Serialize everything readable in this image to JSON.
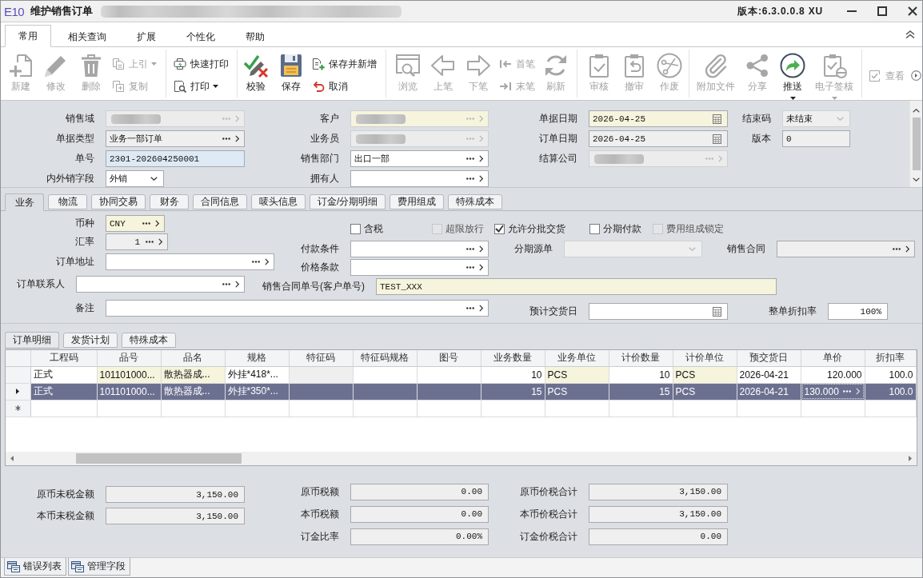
{
  "window": {
    "logo": "E10",
    "title": "维护销售订单",
    "subtitle_redacted": true,
    "version": "版本:6.3.0.0.8 XU"
  },
  "menu_tabs": [
    {
      "label": "常用",
      "selected": true
    },
    {
      "label": "相关查询",
      "selected": false
    },
    {
      "label": "扩展",
      "selected": false
    },
    {
      "label": "个性化",
      "selected": false
    },
    {
      "label": "帮助",
      "selected": false
    }
  ],
  "toolbar": {
    "groups": [
      {
        "items": [
          {
            "kind": "large",
            "label": "新建",
            "disabled": true,
            "dropdown": false
          },
          {
            "kind": "large",
            "label": "修改",
            "disabled": true,
            "dropdown": false
          },
          {
            "kind": "large",
            "label": "删除",
            "disabled": true,
            "dropdown": false
          },
          {
            "kind": "stack",
            "buttons": [
              {
                "label": "上引",
                "disabled": true,
                "dropdown": true
              },
              {
                "label": "复制",
                "disabled": true,
                "dropdown": false
              }
            ]
          }
        ]
      },
      {
        "items": [
          {
            "kind": "stack",
            "buttons": [
              {
                "label": "快速打印",
                "disabled": false,
                "dropdown": false
              },
              {
                "label": "打印",
                "disabled": false,
                "dropdown": true
              }
            ]
          }
        ]
      },
      {
        "items": [
          {
            "kind": "large",
            "label": "校验",
            "disabled": false,
            "dropdown": false
          },
          {
            "kind": "large",
            "label": "保存",
            "disabled": false,
            "dropdown": false
          },
          {
            "kind": "stack",
            "buttons": [
              {
                "label": "保存并新增",
                "disabled": false,
                "dropdown": false
              },
              {
                "label": "取消",
                "disabled": false,
                "dropdown": false
              }
            ]
          }
        ]
      },
      {
        "items": [
          {
            "kind": "large",
            "label": "浏览",
            "disabled": true,
            "dropdown": false
          },
          {
            "kind": "large",
            "label": "上笔",
            "disabled": true,
            "dropdown": false
          },
          {
            "kind": "large",
            "label": "下笔",
            "disabled": true,
            "dropdown": false
          },
          {
            "kind": "stack",
            "buttons": [
              {
                "label": "首笔",
                "disabled": true,
                "dropdown": false
              },
              {
                "label": "末笔",
                "disabled": true,
                "dropdown": false
              }
            ]
          },
          {
            "kind": "large",
            "label": "刷新",
            "disabled": true,
            "dropdown": false
          }
        ]
      },
      {
        "items": [
          {
            "kind": "large",
            "label": "审核",
            "disabled": true,
            "dropdown": false
          },
          {
            "kind": "large",
            "label": "撤审",
            "disabled": true,
            "dropdown": false
          },
          {
            "kind": "large",
            "label": "作废",
            "disabled": true,
            "dropdown": false
          }
        ]
      },
      {
        "items": [
          {
            "kind": "large",
            "label": "附加文件",
            "disabled": true,
            "dropdown": false
          },
          {
            "kind": "large",
            "label": "分享",
            "disabled": true,
            "dropdown": false
          },
          {
            "kind": "large",
            "label": "推送",
            "disabled": false,
            "dropdown": true
          },
          {
            "kind": "large",
            "label": "电子签核",
            "disabled": true,
            "dropdown": true
          }
        ]
      },
      {
        "items": [
          {
            "kind": "stack",
            "buttons": [
              {
                "label": "查看",
                "disabled": true,
                "dropdown": false
              }
            ]
          }
        ]
      }
    ]
  },
  "header_form": {
    "rows": [
      [
        {
          "label": "销售域",
          "kind": "lookup",
          "color": "#ececec",
          "disabled": true,
          "redacted": true
        },
        {
          "label": "客户",
          "kind": "lookup",
          "color": "#f6f4dc",
          "disabled": true,
          "redacted": true
        },
        {
          "label": "单据日期",
          "kind": "date",
          "color": "#f6f4dc",
          "disabled": false,
          "redacted": false,
          "value": "2026-04-25"
        },
        {
          "label": "结束码",
          "kind": "dropdown",
          "color": "#efefef",
          "disabled": true,
          "redacted": false,
          "value": "未结束"
        }
      ],
      [
        {
          "label": "单据类型",
          "kind": "lookup",
          "color": "#efefef",
          "disabled": false,
          "redacted": false,
          "value": "业务一部订单"
        },
        {
          "label": "业务员",
          "kind": "lookup",
          "color": "#ececec",
          "disabled": true,
          "redacted": true
        },
        {
          "label": "订单日期",
          "kind": "date",
          "color": "#efefef",
          "disabled": false,
          "redacted": false,
          "value": "2026-04-25"
        },
        {
          "label": "版本",
          "kind": "text",
          "color": "#efefef",
          "disabled": false,
          "redacted": false,
          "value": "0"
        }
      ],
      [
        {
          "label": "单号",
          "kind": "text",
          "color": "#dde9f5",
          "disabled": false,
          "redacted": false,
          "value": "2301-202604250001"
        },
        {
          "label": "销售部门",
          "kind": "lookup",
          "color": "#ffffff",
          "disabled": false,
          "redacted": false,
          "value": "出口一部"
        },
        {
          "label": "结算公司",
          "kind": "lookup",
          "color": "#ececec",
          "disabled": true,
          "redacted": true
        }
      ],
      [
        {
          "label": "内外销字段",
          "kind": "dropdown",
          "color": "#ffffff",
          "disabled": false,
          "redacted": false,
          "value": "外销"
        },
        {
          "label": "拥有人",
          "kind": "lookup",
          "color": "#ffffff",
          "disabled": false,
          "redacted": false
        }
      ]
    ]
  },
  "form_tabs": [
    {
      "label": "业务",
      "selected": true
    },
    {
      "label": "物流",
      "selected": false
    },
    {
      "label": "协同交易",
      "selected": false
    },
    {
      "label": "财务",
      "selected": false
    },
    {
      "label": "合同信息",
      "selected": false
    },
    {
      "label": "唛头信息",
      "selected": false
    },
    {
      "label": "订金/分期明细",
      "selected": false
    },
    {
      "label": "费用组成",
      "selected": false
    },
    {
      "label": "特殊成本",
      "selected": false
    }
  ],
  "business_form": {
    "fields": [
      {
        "kind": "lookup",
        "label": "币种",
        "color": "#f6f4dc",
        "disabled": false,
        "value": "CNY"
      },
      {
        "kind": "number_lookup",
        "label": "汇率",
        "color": "#efefef",
        "disabled": false,
        "value": "1"
      },
      {
        "kind": "lookup",
        "label": "付款条件",
        "color": "#ffffff",
        "disabled": false
      },
      {
        "kind": "dropdown",
        "label": "分期源单",
        "color": "#efefef",
        "disabled": true
      },
      {
        "kind": "lookup",
        "label": "销售合同",
        "color": "#efefef",
        "disabled": false
      },
      {
        "kind": "lookup",
        "label": "订单地址",
        "color": "#ffffff",
        "disabled": false
      },
      {
        "kind": "lookup",
        "label": "价格条款",
        "color": "#ffffff",
        "disabled": false
      },
      {
        "kind": "lookup",
        "label": "订单联系人",
        "color": "#ffffff",
        "disabled": false
      },
      {
        "kind": "text",
        "label": "销售合同单号(客户单号)",
        "color": "#f6f4dc",
        "disabled": false,
        "value": "TEST_XXX"
      },
      {
        "kind": "lookup",
        "label": "备注",
        "color": "#ffffff",
        "disabled": false
      },
      {
        "kind": "date",
        "label": "预计交货日",
        "color": "#ffffff",
        "disabled": false
      },
      {
        "kind": "number",
        "label": "整单折扣率",
        "color": "#ffffff",
        "disabled": false,
        "value": "100%"
      }
    ],
    "options": [
      {
        "label": "含税",
        "checked": false,
        "disabled": false
      },
      {
        "label": "超限放行",
        "checked": false,
        "disabled": true
      },
      {
        "label": "允许分批交货",
        "checked": true,
        "disabled": false
      },
      {
        "label": "分期付款",
        "checked": false,
        "disabled": false
      },
      {
        "label": "费用组成锁定",
        "checked": false,
        "disabled": true
      }
    ]
  },
  "detail_tabs": [
    {
      "label": "订单明细",
      "selected": true
    },
    {
      "label": "发货计划",
      "selected": false
    },
    {
      "label": "特殊成本",
      "selected": false
    }
  ],
  "detail_grid": {
    "columns": [
      {
        "label": "工程码",
        "kind": "text",
        "color": "#ffffff"
      },
      {
        "label": "品号",
        "kind": "text",
        "color": "#f6f4dc"
      },
      {
        "label": "品名",
        "kind": "text",
        "color": "#f6f4dc"
      },
      {
        "label": "规格",
        "kind": "text",
        "color": "#ffffff"
      },
      {
        "label": "特征码",
        "kind": "text",
        "color": "#efefef"
      },
      {
        "label": "特征码规格",
        "kind": "text",
        "color": "#ffffff"
      },
      {
        "label": "图号",
        "kind": "text",
        "color": "#ffffff"
      },
      {
        "label": "业务数量",
        "kind": "number",
        "color": "#ffffff"
      },
      {
        "label": "业务单位",
        "kind": "text",
        "color": "#f6f4dc"
      },
      {
        "label": "计价数量",
        "kind": "number",
        "color": "#ffffff"
      },
      {
        "label": "计价单位",
        "kind": "text",
        "color": "#f6f4dc"
      },
      {
        "label": "预交货日",
        "kind": "text",
        "color": "#ffffff"
      },
      {
        "label": "单价",
        "kind": "number",
        "color": "#ffffff"
      },
      {
        "label": "折扣率",
        "kind": "number",
        "color": "#ffffff"
      }
    ],
    "rows": [
      {
        "kind": "data",
        "selected": false,
        "current": false,
        "cells": [
          {
            "text": "正式",
            "focused": false
          },
          {
            "text": "101101000...",
            "focused": false
          },
          {
            "text": "散热器成...",
            "focused": false
          },
          {
            "text": "外挂*418*...",
            "focused": false
          },
          {
            "focused": false
          },
          {
            "focused": false
          },
          {
            "focused": false
          },
          {
            "text": "10",
            "focused": false
          },
          {
            "text": "PCS",
            "focused": false
          },
          {
            "text": "10",
            "focused": false
          },
          {
            "text": "PCS",
            "focused": false
          },
          {
            "text": "2026-04-21",
            "focused": false
          },
          {
            "text": "120.000",
            "focused": false
          },
          {
            "text": "100.0",
            "focused": false
          }
        ]
      },
      {
        "kind": "data",
        "selected": true,
        "current": true,
        "cells": [
          {
            "text": "正式",
            "focused": false
          },
          {
            "text": "101101000...",
            "focused": false
          },
          {
            "text": "散热器成...",
            "focused": false
          },
          {
            "text": "外挂*350*...",
            "focused": false
          },
          {
            "focused": false
          },
          {
            "focused": false
          },
          {
            "focused": false
          },
          {
            "text": "15",
            "focused": false
          },
          {
            "text": "PCS",
            "focused": false
          },
          {
            "text": "15",
            "focused": false
          },
          {
            "text": "PCS",
            "focused": false
          },
          {
            "text": "2026-04-21",
            "focused": false
          },
          {
            "text": "130.000",
            "focused": true
          },
          {
            "text": "100.0",
            "focused": false
          }
        ]
      },
      {
        "kind": "new",
        "selected": false,
        "current": false
      }
    ]
  },
  "totals": {
    "columns": [
      [
        {
          "label": "原币未税金额",
          "value": "3,150.00"
        },
        {
          "label": "本币未税金额",
          "value": "3,150.00"
        }
      ],
      [
        {
          "label": "原币税额",
          "value": "0.00"
        },
        {
          "label": "本币税额",
          "value": "0.00"
        },
        {
          "label": "订金比率",
          "value": "0.00%"
        }
      ],
      [
        {
          "label": "原币价税合计",
          "value": "3,150.00"
        },
        {
          "label": "本币价税合计",
          "value": "3,150.00"
        },
        {
          "label": "订金价税合计",
          "value": "0.00"
        }
      ]
    ]
  },
  "bottom_tabs": [
    {
      "label": "错误列表",
      "selected": false
    },
    {
      "label": "管理字段",
      "selected": false
    }
  ]
}
